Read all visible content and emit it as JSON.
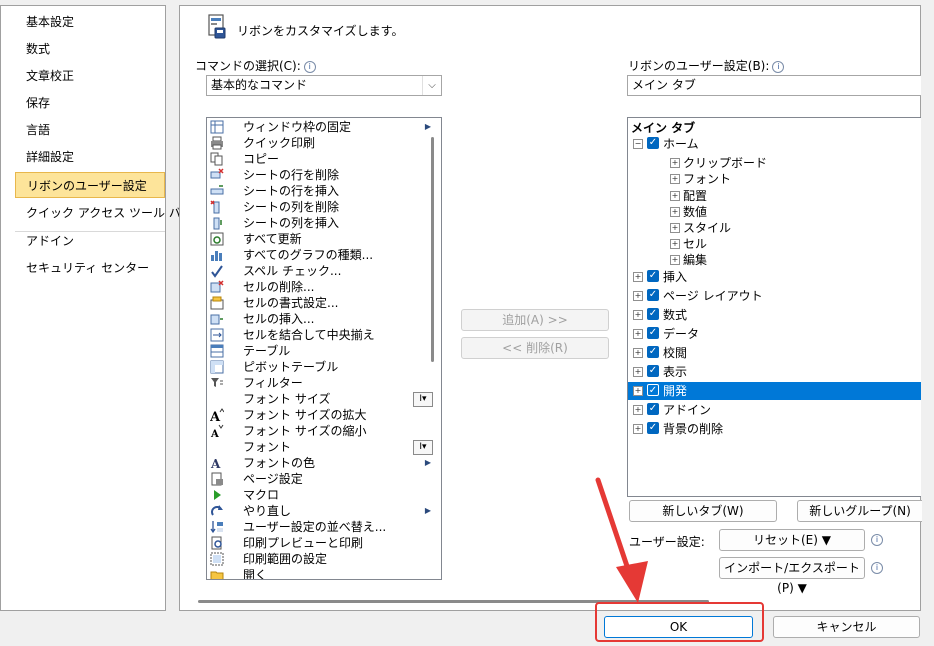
{
  "nav": {
    "items": [
      "基本設定",
      "数式",
      "文章校正",
      "保存",
      "言語",
      "詳細設定",
      "リボンのユーザー設定",
      "クイック アクセス ツール バー",
      "アドイン",
      "セキュリティ センター"
    ],
    "selected": "リボンのユーザー設定"
  },
  "header": {
    "title": "リボンをカスタマイズします。"
  },
  "commands": {
    "label": "コマンドの選択(C):",
    "selected": "基本的なコマンド",
    "items": [
      {
        "label": "ウィンドウ枠の固定",
        "icon": "freeze-panes-icon",
        "extra": "submenu"
      },
      {
        "label": "クイック印刷",
        "icon": "quick-print-icon"
      },
      {
        "label": "コピー",
        "icon": "copy-icon"
      },
      {
        "label": "シートの行を削除",
        "icon": "delete-row-icon"
      },
      {
        "label": "シートの行を挿入",
        "icon": "insert-row-icon"
      },
      {
        "label": "シートの列を削除",
        "icon": "delete-column-icon"
      },
      {
        "label": "シートの列を挿入",
        "icon": "insert-column-icon"
      },
      {
        "label": "すべて更新",
        "icon": "refresh-all-icon"
      },
      {
        "label": "すべてのグラフの種類...",
        "icon": "chart-types-icon"
      },
      {
        "label": "スペル チェック...",
        "icon": "spell-check-icon"
      },
      {
        "label": "セルの削除...",
        "icon": "delete-cells-icon"
      },
      {
        "label": "セルの書式設定...",
        "icon": "format-cells-icon"
      },
      {
        "label": "セルの挿入...",
        "icon": "insert-cells-icon"
      },
      {
        "label": "セルを結合して中央揃え",
        "icon": "merge-center-icon"
      },
      {
        "label": "テーブル",
        "icon": "table-icon"
      },
      {
        "label": "ピボットテーブル",
        "icon": "pivot-table-icon"
      },
      {
        "label": "フィルター",
        "icon": "filter-icon"
      },
      {
        "label": "フォント サイズ",
        "icon": "none",
        "extra": "input"
      },
      {
        "label": "フォント サイズの拡大",
        "icon": "font-grow-icon"
      },
      {
        "label": "フォント サイズの縮小",
        "icon": "font-shrink-icon"
      },
      {
        "label": "フォント",
        "icon": "none",
        "extra": "input"
      },
      {
        "label": "フォントの色",
        "icon": "font-color-icon",
        "extra": "submenu"
      },
      {
        "label": "ページ設定",
        "icon": "page-setup-icon"
      },
      {
        "label": "マクロ",
        "icon": "macro-icon"
      },
      {
        "label": "やり直し",
        "icon": "redo-icon",
        "extra": "submenu"
      },
      {
        "label": "ユーザー設定の並べ替え...",
        "icon": "custom-sort-icon"
      },
      {
        "label": "印刷プレビューと印刷",
        "icon": "print-preview-icon"
      },
      {
        "label": "印刷範囲の設定",
        "icon": "print-area-icon"
      },
      {
        "label": "開く",
        "icon": "open-icon"
      }
    ]
  },
  "middle": {
    "add": "追加(A) >>",
    "remove": "<< 削除(R)"
  },
  "ribbon": {
    "label": "リボンのユーザー設定(B):",
    "selected": "メイン タブ",
    "header": "メイン タブ",
    "tree": [
      {
        "label": "ホーム",
        "level": 0,
        "expanded": true,
        "checked": true
      },
      {
        "label": "クリップボード",
        "level": 1
      },
      {
        "label": "フォント",
        "level": 1
      },
      {
        "label": "配置",
        "level": 1
      },
      {
        "label": "数値",
        "level": 1
      },
      {
        "label": "スタイル",
        "level": 1
      },
      {
        "label": "セル",
        "level": 1
      },
      {
        "label": "編集",
        "level": 1
      },
      {
        "label": "挿入",
        "level": 0,
        "checked": true
      },
      {
        "label": "ページ レイアウト",
        "level": 0,
        "checked": true
      },
      {
        "label": "数式",
        "level": 0,
        "checked": true
      },
      {
        "label": "データ",
        "level": 0,
        "checked": true
      },
      {
        "label": "校閲",
        "level": 0,
        "checked": true
      },
      {
        "label": "表示",
        "level": 0,
        "checked": true
      },
      {
        "label": "開発",
        "level": 0,
        "checked": true,
        "selected": true
      },
      {
        "label": "アドイン",
        "level": 0,
        "checked": true
      },
      {
        "label": "背景の削除",
        "level": 0,
        "checked": true
      }
    ],
    "new_tab": "新しいタブ(W)",
    "new_group": "新しいグループ(N)",
    "user_settings_label": "ユーザー設定:",
    "reset": "リセット(E) ▼",
    "import_export": "インポート/エクスポート(P) ▼"
  },
  "footer": {
    "ok": "OK",
    "cancel": "キャンセル"
  },
  "colors": {
    "accent": "#0078d7",
    "nav_selected": "#fde49a",
    "highlight_border": "#e53935"
  }
}
